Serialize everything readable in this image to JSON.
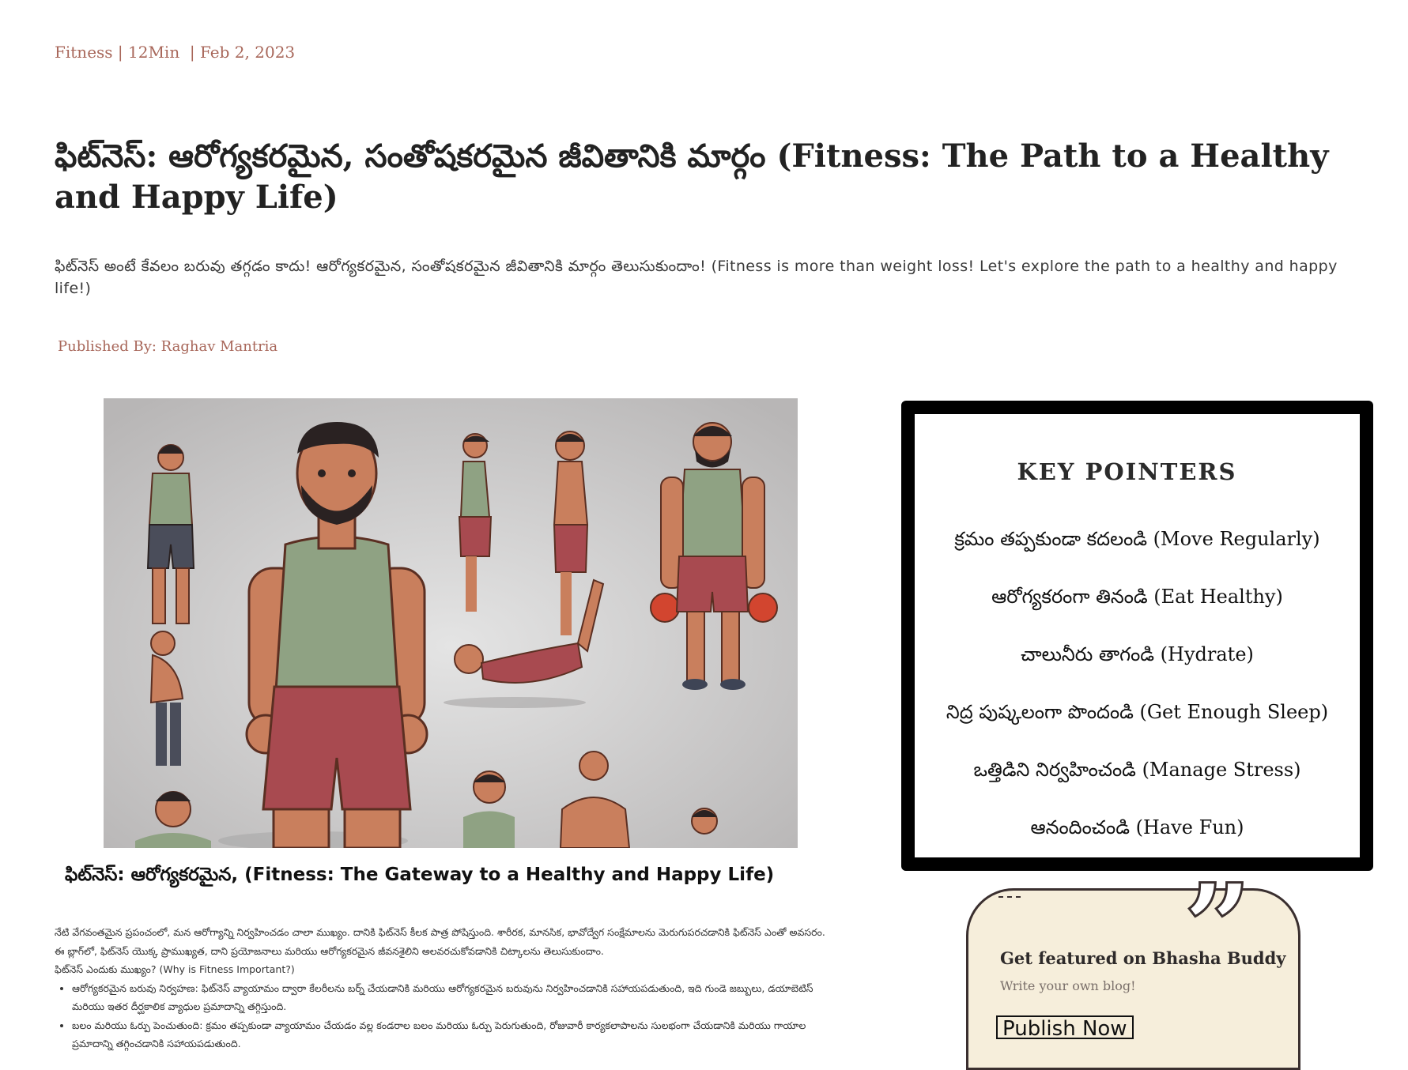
{
  "meta": {
    "category": "Fitness",
    "read_time": "12Min",
    "date": "Feb 2, 2023",
    "line": "Fitness | 12Min  | Feb 2, 2023"
  },
  "article": {
    "title": "ఫిట్‌నెస్: ఆరోగ్యకరమైన, సంతోషకరమైన జీవితానికి మార్గం (Fitness: The Path to a Healthy and Happy Life)",
    "subtitle": "ఫిట్‌నెస్ అంటే కేవలం బరువు తగ్గడం కాదు! ఆరోగ్యకరమైన, సంతోషకరమైన జీవితానికి మార్గం తెలుసుకుందాం! (Fitness is more than weight loss! Let's explore the path to a healthy and happy life!)",
    "byline": "Published By: Raghav Mantria",
    "image_caption": "ఫిట్‌నెస్: ఆరోగ్యకరమైన,  (Fitness: The Gateway to a Healthy and Happy Life)",
    "intro": "నేటి వేగవంతమైన ప్రపంచంలో, మన ఆరోగ్యాన్ని నిర్వహించడం చాలా ముఖ్యం. దానికి ఫిట్‌నెస్ కీలక పాత్ర పోషిస్తుంది. శారీరక, మానసిక, భావోద్వేగ సంక్షేమాలను మెరుగుపరచడానికి ఫిట్‌నెస్ ఎంతో అవసరం. ఈ బ్లాగ్‌లో, ఫిట్‌నెస్ యొక్క ప్రాముఖ్యత, దాని ప్రయోజనాలు మరియు ఆరోగ్యకరమైన జీవనశైలిని అలవరచుకోవడానికి చిట్కాలను తెలుసుకుందాం.",
    "why_heading": "ఫిట్‌నెస్ ఎందుకు ముఖ్యం? (Why is Fitness Important?)",
    "bullets": [
      "ఆరోగ్యకరమైన బరువు నిర్వహణ: ఫిట్‌నెస్ వ్యాయామం ద్వారా కేలరీలను బర్న్ చేయడానికి మరియు ఆరోగ్యకరమైన బరువును నిర్వహించడానికి సహాయపడుతుంది, ఇది గుండె జబ్బులు, డయాబెటిస్ మరియు ఇతర దీర్ఘకాలిక వ్యాధుల ప్రమాదాన్ని తగ్గిస్తుంది.",
      "బలం మరియు ఓర్పు పెంచుతుంది: క్రమం తప్పకుండా వ్యాయామం చేయడం వల్ల కండరాల బలం మరియు ఓర్పు పెరుగుతుంది, రోజువారీ కార్యకలాపాలను సులభంగా చేయడానికి మరియు గాయాల ప్రమాదాన్ని తగ్గించడానికి సహాయపడుతుంది."
    ]
  },
  "key_pointers": {
    "heading": "KEY POINTERS",
    "items": [
      "క్రమం తప్పకుండా కదలండి (Move Regularly)",
      "ఆరోగ్యకరంగా తినండి (Eat Healthy)",
      "చాలునీరు తాగండి (Hydrate)",
      "నిద్ర పుష్కలంగా పొందండి (Get Enough Sleep)",
      "ఒత్తిడిని నిర్వహించండి (Manage Stress)",
      "ఆనందించండి (Have Fun)"
    ]
  },
  "feature": {
    "title": "Get featured on Bhasha Buddy",
    "subtitle": "Write your own blog!",
    "button": "Publish Now"
  },
  "colors": {
    "accent": "#a8675a",
    "box_border": "#000000",
    "feature_bg": "#f6eedb",
    "shirt": "#8fa283",
    "shorts": "#a84a50",
    "skin": "#c97f5d"
  },
  "icons": [
    "quote-icon"
  ]
}
